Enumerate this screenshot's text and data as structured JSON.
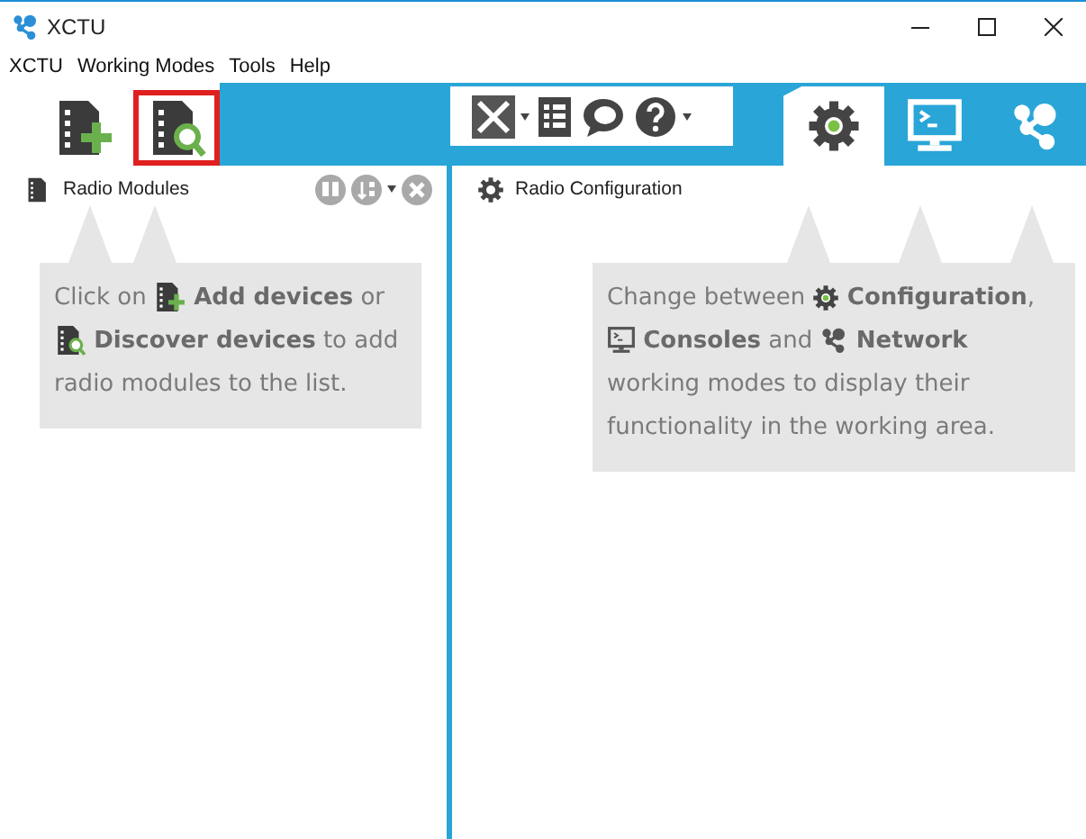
{
  "window": {
    "title": "XCTU"
  },
  "menu": [
    "XCTU",
    "Working Modes",
    "Tools",
    "Help"
  ],
  "device_buttons": [
    {
      "kind": "add",
      "highlighted": false
    },
    {
      "kind": "discover",
      "highlighted": true
    }
  ],
  "tools": [
    {
      "kind": "tools",
      "dropdown": true
    },
    {
      "kind": "list",
      "dropdown": false
    },
    {
      "kind": "chat",
      "dropdown": false
    },
    {
      "kind": "help",
      "dropdown": true
    }
  ],
  "modes": [
    {
      "kind": "configuration",
      "selected": true
    },
    {
      "kind": "consoles",
      "selected": false
    },
    {
      "kind": "network",
      "selected": false
    }
  ],
  "left_panel": {
    "title": "Radio Modules",
    "hint": [
      {
        "kind": "text",
        "text": "Click on "
      },
      {
        "kind": "add"
      },
      {
        "kind": "text",
        "text": " **Add devices** or "
      },
      {
        "kind": "discover"
      },
      {
        "kind": "text",
        "text": " **Discover devices** to add radio modules to the list."
      }
    ]
  },
  "right_panel": {
    "title": "Radio Configuration",
    "hint": [
      {
        "kind": "text",
        "text": "Change between "
      },
      {
        "kind": "configuration"
      },
      {
        "kind": "text",
        "text": " **Configuration**, "
      },
      {
        "kind": "consoles"
      },
      {
        "kind": "text",
        "text": " **Consoles** and "
      },
      {
        "kind": "network"
      },
      {
        "kind": "text",
        "text": " **Network** working modes to display their functionality in the working area."
      }
    ]
  }
}
